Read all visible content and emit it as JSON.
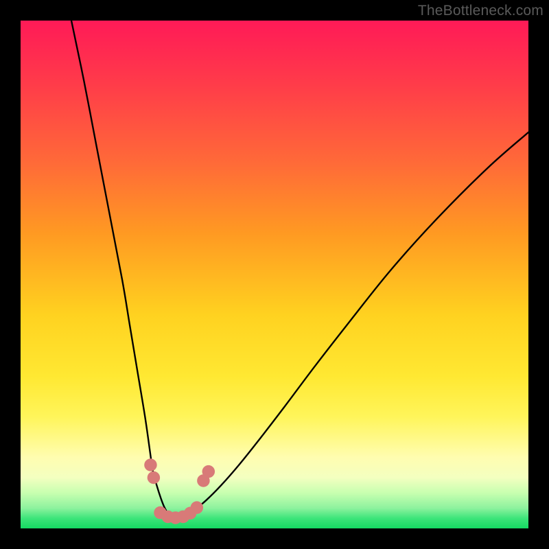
{
  "watermark": "TheBottleneck.com",
  "colors": {
    "frame": "#000000",
    "curve_stroke": "#000000",
    "marker_fill": "#d87a78",
    "gradient_top": "#ff1a57",
    "gradient_mid": "#ffe832",
    "gradient_bottom": "#15da62"
  },
  "chart_data": {
    "type": "line",
    "title": "",
    "xlabel": "",
    "ylabel": "",
    "xlim": [
      0,
      100
    ],
    "ylim": [
      0,
      100
    ],
    "note": "Axes are unlabeled in the source image; x and y are in percent of plot width/height with y=0 at the bottom (green) and y=100 at the top (red). Two black curves descend from the top edge, meet near the bottom-center-left, and the right curve rises back toward the upper-right. Salmon-colored circular markers sit along the valley of the curves.",
    "series": [
      {
        "name": "left-curve",
        "x": [
          10.0,
          12.5,
          15.0,
          17.5,
          20.0,
          21.5,
          23.0,
          24.5,
          25.5,
          26.0,
          26.8,
          27.6,
          28.3,
          29.0,
          29.8,
          30.5
        ],
        "y": [
          100.0,
          88.0,
          75.0,
          62.0,
          49.0,
          40.0,
          31.0,
          22.0,
          15.0,
          11.5,
          8.5,
          6.0,
          4.2,
          3.0,
          2.3,
          2.0
        ]
      },
      {
        "name": "right-curve",
        "x": [
          30.5,
          32.0,
          34.0,
          36.5,
          39.5,
          43.0,
          47.0,
          52.0,
          58.0,
          65.0,
          73.0,
          82.0,
          92.0,
          100.0
        ],
        "y": [
          2.0,
          2.4,
          3.5,
          5.5,
          8.5,
          12.5,
          17.5,
          24.0,
          32.0,
          41.0,
          51.0,
          61.0,
          71.0,
          78.0
        ]
      }
    ],
    "markers": [
      {
        "x": 25.6,
        "y": 12.5
      },
      {
        "x": 26.2,
        "y": 10.0
      },
      {
        "x": 27.5,
        "y": 3.1
      },
      {
        "x": 29.0,
        "y": 2.3
      },
      {
        "x": 30.5,
        "y": 2.1
      },
      {
        "x": 32.0,
        "y": 2.3
      },
      {
        "x": 33.4,
        "y": 3.0
      },
      {
        "x": 34.7,
        "y": 4.1
      },
      {
        "x": 36.0,
        "y": 9.4
      },
      {
        "x": 37.0,
        "y": 11.2
      }
    ],
    "marker_radius_pct": 1.25
  }
}
